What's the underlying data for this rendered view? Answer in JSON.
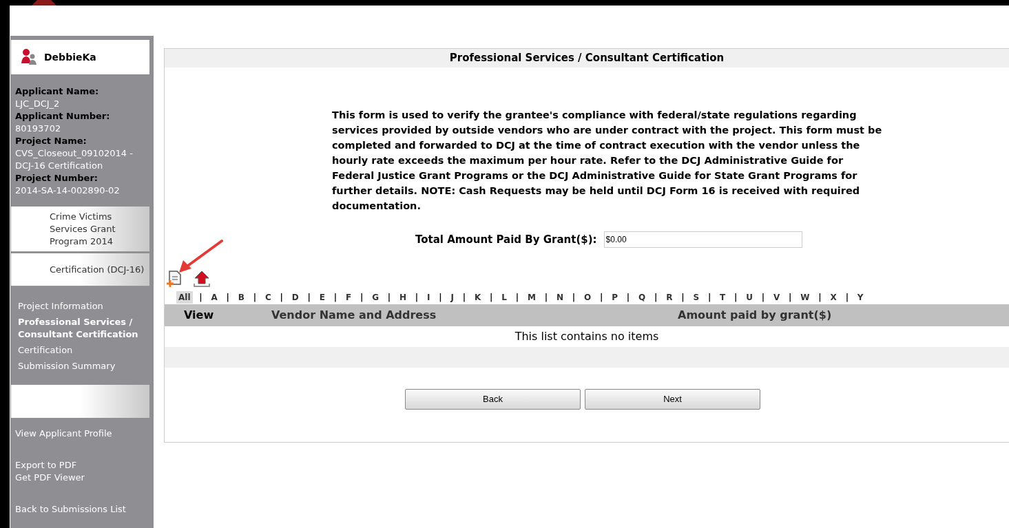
{
  "user": {
    "name": "DebbieKa"
  },
  "applicant_info": [
    {
      "label": "Applicant Name:",
      "value": "LJC_DCJ_2"
    },
    {
      "label": "Applicant Number:",
      "value": "80193702"
    },
    {
      "label": "Project Name:",
      "value": "CVS_Closeout_09102014 - DCJ-16 Certification"
    },
    {
      "label": "Project Number:",
      "value": "2014-SA-14-002890-02"
    }
  ],
  "program_buttons": [
    "Crime Victims Services Grant Program 2014",
    "Certification (DCJ-16)"
  ],
  "nav_items": [
    {
      "label": "Project Information",
      "selected": false
    },
    {
      "label": "Professional Services / Consultant Certification",
      "selected": true
    },
    {
      "label": "Certification",
      "selected": false
    },
    {
      "label": "Submission Summary",
      "selected": false
    }
  ],
  "sidebar_links": [
    [
      "View Applicant Profile"
    ],
    [
      "Export to PDF",
      "Get PDF Viewer"
    ],
    [
      "Back to Submissions List"
    ]
  ],
  "page_title": "Professional Services / Consultant Certification",
  "instructions": "This form is used to verify the grantee's compliance with federal/state regulations regarding services provided by outside vendors who are under contract with the project. This form must be completed and forwarded to DCJ at the time of contract execution with the vendor unless the hourly rate exceeds the maximum per hour rate. Refer to the DCJ Administrative Guide for Federal Justice Grant Programs or the DCJ Administrative Guide for State Grant Programs for further details. NOTE: Cash Requests may be held until DCJ Form 16 is received with required documentation.",
  "total_field": {
    "label": "Total Amount Paid By Grant($):",
    "value": "$0.00"
  },
  "alphabet_filter": [
    {
      "label": "All",
      "selected": true
    },
    {
      "label": "A",
      "selected": false
    },
    {
      "label": "B",
      "selected": false
    },
    {
      "label": "C",
      "selected": false
    },
    {
      "label": "D",
      "selected": false
    },
    {
      "label": "E",
      "selected": false
    },
    {
      "label": "F",
      "selected": false
    },
    {
      "label": "G",
      "selected": false
    },
    {
      "label": "H",
      "selected": false
    },
    {
      "label": "I",
      "selected": false
    },
    {
      "label": "J",
      "selected": false
    },
    {
      "label": "K",
      "selected": false
    },
    {
      "label": "L",
      "selected": false
    },
    {
      "label": "M",
      "selected": false
    },
    {
      "label": "N",
      "selected": false
    },
    {
      "label": "O",
      "selected": false
    },
    {
      "label": "P",
      "selected": false
    },
    {
      "label": "Q",
      "selected": false
    },
    {
      "label": "R",
      "selected": false
    },
    {
      "label": "S",
      "selected": false
    },
    {
      "label": "T",
      "selected": false
    },
    {
      "label": "U",
      "selected": false
    },
    {
      "label": "V",
      "selected": false
    },
    {
      "label": "W",
      "selected": false
    },
    {
      "label": "X",
      "selected": false
    },
    {
      "label": "Y",
      "selected": false
    }
  ],
  "alphabet_separator": "|",
  "table": {
    "columns": [
      "View",
      "Vendor Name and Address",
      "Amount paid by grant($)"
    ],
    "empty_message": "This list contains no items"
  },
  "buttons": [
    "Back",
    "Next"
  ]
}
